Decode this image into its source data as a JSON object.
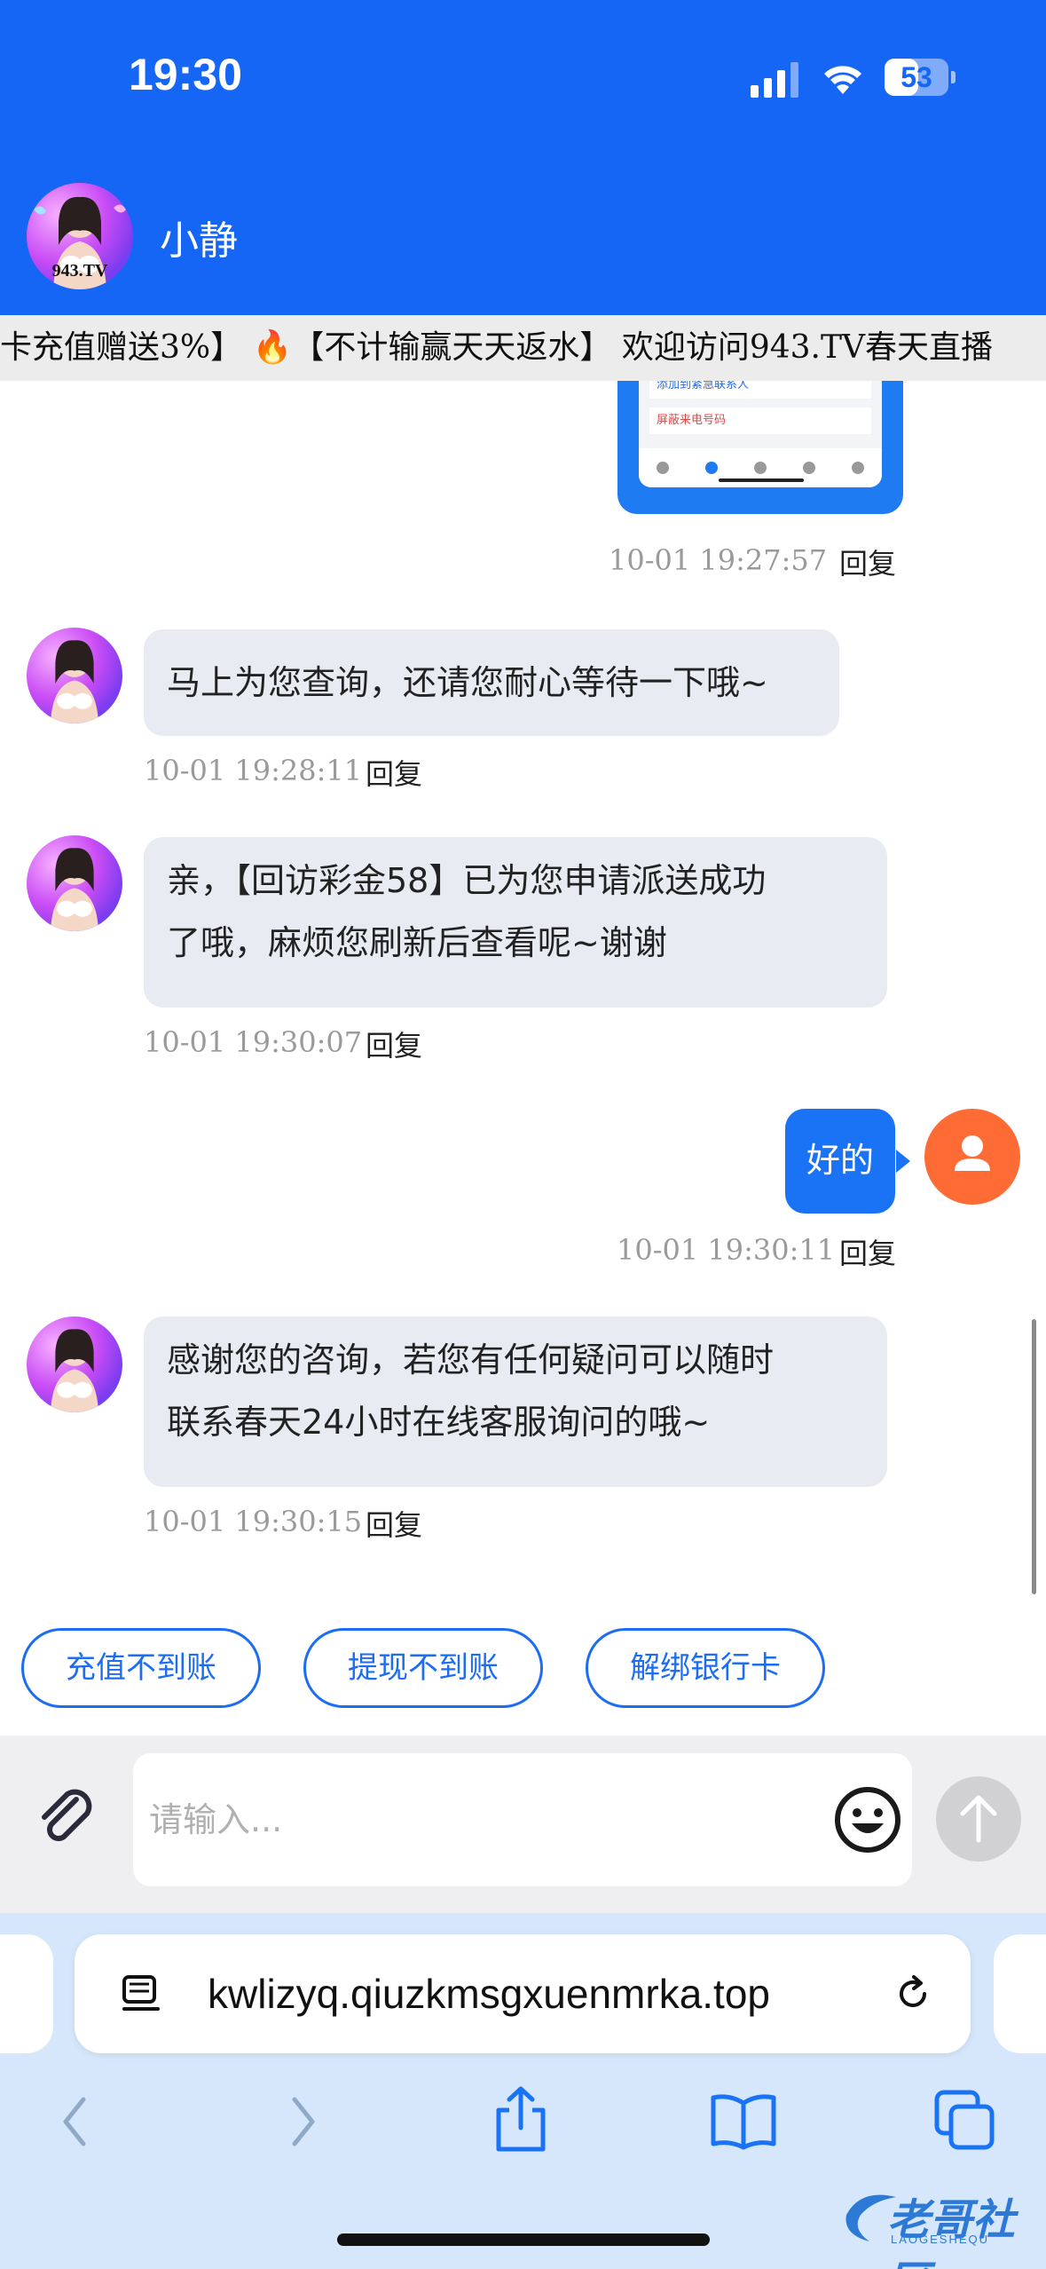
{
  "status_bar": {
    "time": "19:30",
    "battery": "53",
    "battery_fraction": 0.53
  },
  "header": {
    "agent_name": "小静",
    "avatar_caption": "943.TV"
  },
  "marquee": {
    "text": "卡充值赠送3%】 🔥【不计输赢天天返水】 欢迎访问943.TV春天直播"
  },
  "prev_image": {
    "row1": "添加到紧急联系人",
    "row2": "屏蔽来电号码"
  },
  "messages": [
    {
      "from": "agent",
      "text": "马上为您查询，还请您耐心等待一下哦~",
      "time": "10-01 19:28:11",
      "reply": "回复"
    },
    {
      "from": "agent",
      "lines": [
        "亲，【回访彩金58】已为您申请派送成功",
        "了哦，麻烦您刷新后查看呢~谢谢"
      ],
      "time": "10-01 19:30:07",
      "reply": "回复"
    },
    {
      "from": "user",
      "text": "好的",
      "time": "10-01 19:30:11",
      "reply": "回复"
    },
    {
      "from": "agent",
      "lines": [
        "感谢您的咨询，若您有任何疑问可以随时",
        "联系春天24小时在线客服询问的哦~"
      ],
      "time": "10-01 19:30:15",
      "reply": "回复"
    }
  ],
  "prev_message": {
    "time": "10-01 19:27:57",
    "reply": "回复"
  },
  "quick_replies": [
    "充值不到账",
    "提现不到账",
    "解绑银行卡"
  ],
  "input": {
    "placeholder": "请输入..."
  },
  "browser": {
    "url": "kwlizyq.qiuzkmsgxuenmrka.top"
  },
  "watermark": {
    "text": "老哥社区",
    "subtext": "LAOGESHEQU"
  },
  "colors": {
    "header_blue": "#1666f5",
    "bubble_mine": "#1a73f4",
    "bubble_agent": "#e8ebf2",
    "user_avatar": "#ff6b35"
  }
}
